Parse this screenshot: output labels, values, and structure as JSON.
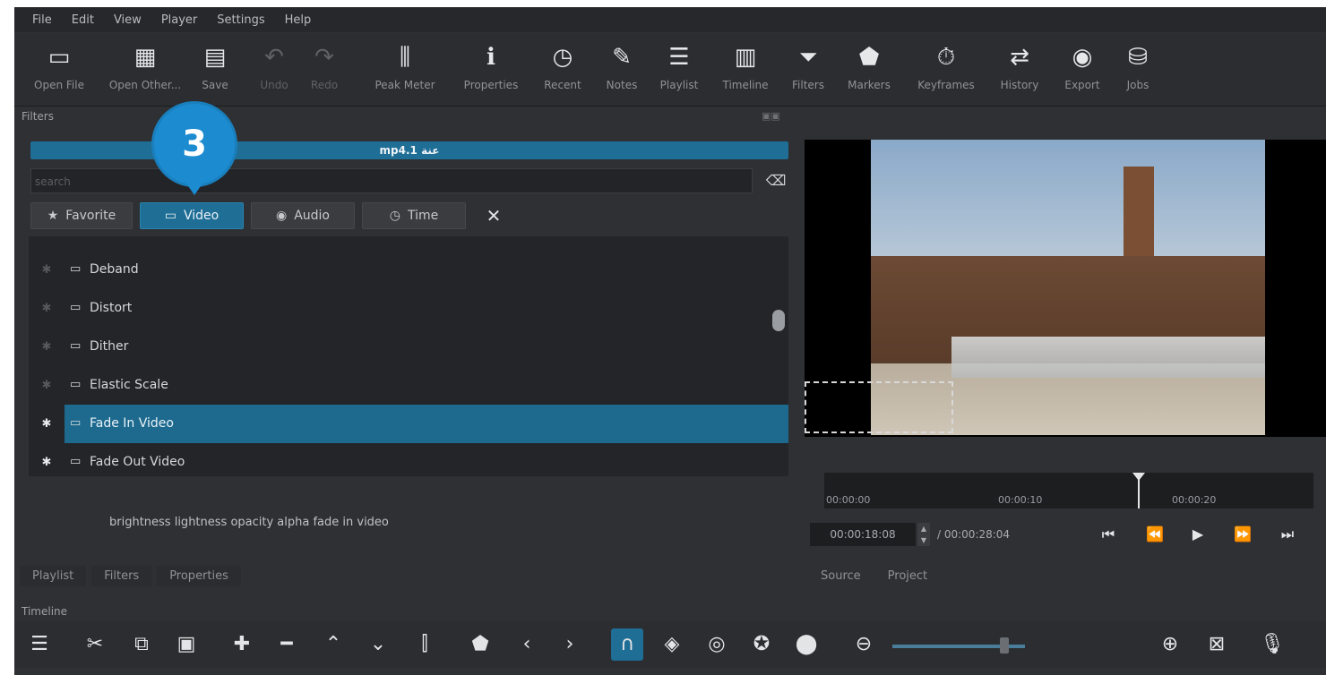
{
  "menu": [
    "File",
    "Edit",
    "View",
    "Player",
    "Settings",
    "Help"
  ],
  "toolbar": [
    {
      "label": "Open File",
      "icon": "folder-icon",
      "glyph": "▭"
    },
    {
      "label": "Open Other...",
      "icon": "open-other-icon",
      "glyph": "▦"
    },
    {
      "label": "Save",
      "icon": "save-icon",
      "glyph": "▤"
    },
    {
      "label": "Undo",
      "icon": "undo-icon",
      "glyph": "↶"
    },
    {
      "label": "Redo",
      "icon": "redo-icon",
      "glyph": "↷"
    },
    {
      "label": "Peak Meter",
      "icon": "peak-meter-icon",
      "glyph": "⫼"
    },
    {
      "label": "Properties",
      "icon": "info-icon",
      "glyph": "ℹ"
    },
    {
      "label": "Recent",
      "icon": "clock-icon",
      "glyph": "◷"
    },
    {
      "label": "Notes",
      "icon": "notes-icon",
      "glyph": "✎"
    },
    {
      "label": "Playlist",
      "icon": "playlist-icon",
      "glyph": "☰"
    },
    {
      "label": "Timeline",
      "icon": "timeline-icon",
      "glyph": "▥"
    },
    {
      "label": "Filters",
      "icon": "filter-icon",
      "glyph": "⏷"
    },
    {
      "label": "Markers",
      "icon": "marker-icon",
      "glyph": "⬟"
    },
    {
      "label": "Keyframes",
      "icon": "stopwatch-icon",
      "glyph": "⏱"
    },
    {
      "label": "History",
      "icon": "history-icon",
      "glyph": "⇄"
    },
    {
      "label": "Export",
      "icon": "export-icon",
      "glyph": "◉"
    },
    {
      "label": "Jobs",
      "icon": "jobs-icon",
      "glyph": "⛁"
    }
  ],
  "filters_panel": {
    "title": "Filters",
    "clip_name": "mp4.1 عنة",
    "search_placeholder": "search",
    "tabs": [
      "Favorite",
      "Video",
      "Audio",
      "Time"
    ],
    "items": [
      {
        "label": "Deband",
        "favorite": false,
        "selected": false
      },
      {
        "label": "Distort",
        "favorite": false,
        "selected": false
      },
      {
        "label": "Dither",
        "favorite": false,
        "selected": false
      },
      {
        "label": "Elastic Scale",
        "favorite": false,
        "selected": false
      },
      {
        "label": "Fade In Video",
        "favorite": true,
        "selected": true
      },
      {
        "label": "Fade Out Video",
        "favorite": true,
        "selected": false
      }
    ],
    "description": "brightness lightness opacity alpha fade in video",
    "bottom_tabs": [
      "Playlist",
      "Filters",
      "Properties"
    ]
  },
  "callout": {
    "number": "3"
  },
  "player": {
    "ruler_ticks": [
      "00:00:00",
      "00:00:10",
      "00:00:20"
    ],
    "timecode": "00:00:18:08",
    "duration": "/ 00:00:28:04",
    "tabs": [
      "Source",
      "Project"
    ]
  },
  "timeline": {
    "title": "Timeline"
  }
}
